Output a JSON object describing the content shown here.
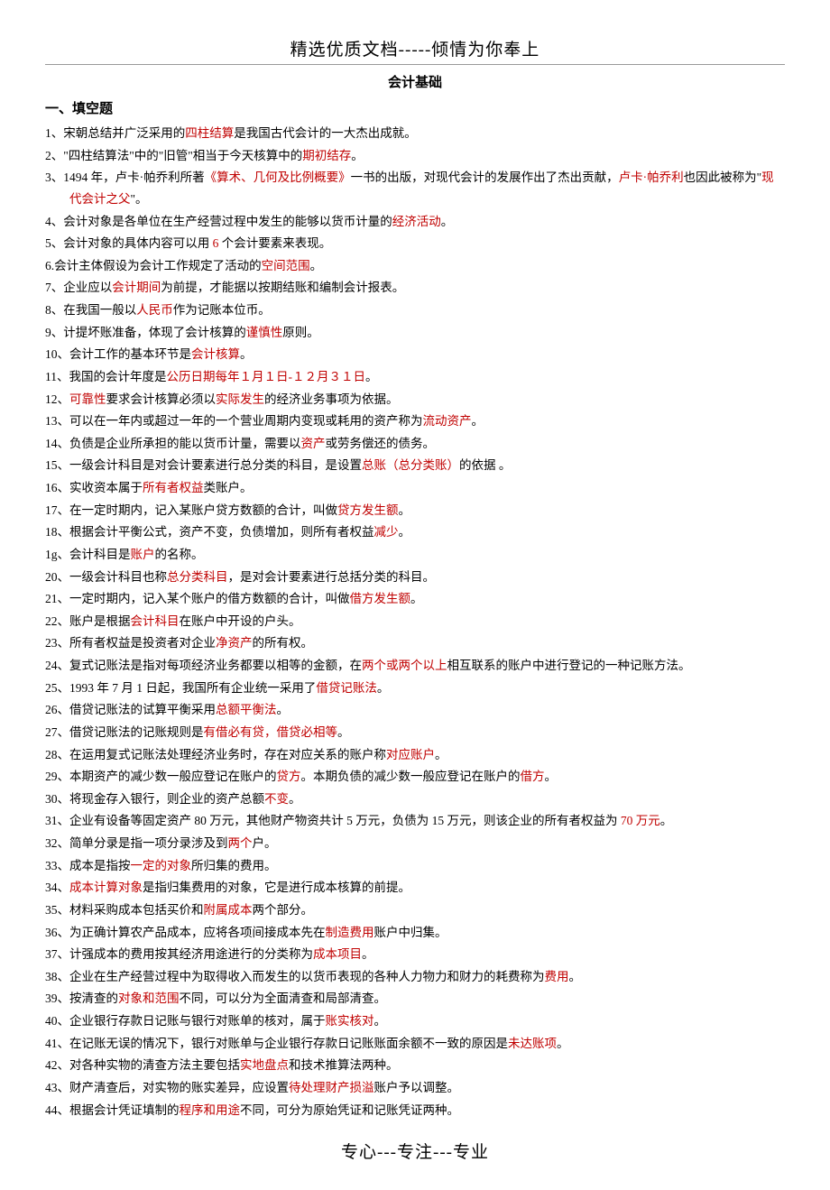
{
  "header": {
    "top": "精选优质文档-----倾情为你奉上",
    "title": "会计基础"
  },
  "section": {
    "title": "一、填空题"
  },
  "items": [
    {
      "n": "1、",
      "parts": [
        {
          "t": "宋朝总结并广泛采用的"
        },
        {
          "t": "四柱结算",
          "r": true
        },
        {
          "t": "是我国古代会计的一大杰出成就。"
        }
      ]
    },
    {
      "n": "2、",
      "parts": [
        {
          "t": "\"四柱结算法\"中的\"旧管\"相当于今天核算中的"
        },
        {
          "t": "期初结存",
          "r": true
        },
        {
          "t": "。"
        }
      ]
    },
    {
      "n": "3、",
      "parts": [
        {
          "t": "1494 年，卢卡·帕乔利所著"
        },
        {
          "t": "《算术、几何及比例概要》",
          "r": true
        },
        {
          "t": "一书的出版，对现代会计的发展作出了杰出贡献，"
        },
        {
          "t": "卢卡·帕乔利",
          "r": true
        },
        {
          "t": "也因此被称为\""
        },
        {
          "t": "现代会计之父",
          "r": true
        },
        {
          "t": "\"。"
        }
      ]
    },
    {
      "n": "4、",
      "parts": [
        {
          "t": "会计对象是各单位在生产经营过程中发生的能够以货币计量的"
        },
        {
          "t": "经济活动",
          "r": true
        },
        {
          "t": "。"
        }
      ]
    },
    {
      "n": "5、",
      "parts": [
        {
          "t": "会计对象的具体内容可以用 "
        },
        {
          "t": "6",
          "r": true
        },
        {
          "t": " 个会计要素来表现。"
        }
      ]
    },
    {
      "n": "6.",
      "parts": [
        {
          "t": "会计主体假设为会计工作规定了活动的"
        },
        {
          "t": "空间范围",
          "r": true
        },
        {
          "t": "。"
        }
      ]
    },
    {
      "n": "7、",
      "parts": [
        {
          "t": "企业应以"
        },
        {
          "t": "会计期间",
          "r": true
        },
        {
          "t": "为前提，才能据以按期结账和编制会计报表。"
        }
      ]
    },
    {
      "n": "8、",
      "parts": [
        {
          "t": "在我国一般以"
        },
        {
          "t": "人民币",
          "r": true
        },
        {
          "t": "作为记账本位币。"
        }
      ]
    },
    {
      "n": "9、",
      "parts": [
        {
          "t": "计提坏账准备，体现了会计核算的"
        },
        {
          "t": "谨慎性",
          "r": true
        },
        {
          "t": "原则。"
        }
      ]
    },
    {
      "n": "10、",
      "parts": [
        {
          "t": "会计工作的基本环节是"
        },
        {
          "t": "会计核算",
          "r": true
        },
        {
          "t": "。"
        }
      ]
    },
    {
      "n": "11、",
      "parts": [
        {
          "t": "我国的会计年度是"
        },
        {
          "t": "公历日期每年１月１日-１２月３１日",
          "r": true
        },
        {
          "t": "。"
        }
      ]
    },
    {
      "n": "12、",
      "parts": [
        {
          "t": "可靠性",
          "r": true
        },
        {
          "t": "要求会计核算必须以"
        },
        {
          "t": "实际发生",
          "r": true
        },
        {
          "t": "的经济业务事项为依据。"
        }
      ]
    },
    {
      "n": "13、",
      "parts": [
        {
          "t": "可以在一年内或超过一年的一个营业周期内变现或耗用的资产称为"
        },
        {
          "t": "流动资产",
          "r": true
        },
        {
          "t": "。"
        }
      ]
    },
    {
      "n": "14、",
      "parts": [
        {
          "t": "负债是企业所承担的能以货币计量，需要以"
        },
        {
          "t": "资产",
          "r": true
        },
        {
          "t": "或劳务偿还的债务。"
        }
      ]
    },
    {
      "n": "15、",
      "parts": [
        {
          "t": "一级会计科目是对会计要素进行总分类的科目，是设置"
        },
        {
          "t": "总账（总分类账）",
          "r": true
        },
        {
          "t": "的依据 。"
        }
      ]
    },
    {
      "n": "16、",
      "parts": [
        {
          "t": "实收资本属于"
        },
        {
          "t": "所有者权益",
          "r": true
        },
        {
          "t": "类账户。"
        }
      ]
    },
    {
      "n": "17、",
      "parts": [
        {
          "t": "在一定时期内，记入某账户贷方数额的合计，叫做"
        },
        {
          "t": "贷方发生额",
          "r": true
        },
        {
          "t": "。"
        }
      ]
    },
    {
      "n": "18、",
      "parts": [
        {
          "t": "根据会计平衡公式，资产不变，负债增加，则所有者权益"
        },
        {
          "t": "减少",
          "r": true
        },
        {
          "t": "。"
        }
      ]
    },
    {
      "n": "1g、",
      "parts": [
        {
          "t": "会计科目是"
        },
        {
          "t": "账户",
          "r": true
        },
        {
          "t": "的名称。"
        }
      ]
    },
    {
      "n": "20、",
      "parts": [
        {
          "t": "一级会计科目也称"
        },
        {
          "t": "总分类科目",
          "r": true
        },
        {
          "t": "，是对会计要素进行总括分类的科目。"
        }
      ]
    },
    {
      "n": "21、",
      "parts": [
        {
          "t": "一定时期内，记入某个账户的借方数额的合计，叫做"
        },
        {
          "t": "借方发生额",
          "r": true
        },
        {
          "t": "。"
        }
      ]
    },
    {
      "n": "22、",
      "parts": [
        {
          "t": "账户是根据"
        },
        {
          "t": "会计科目",
          "r": true
        },
        {
          "t": "在账户中开设的户头。"
        }
      ]
    },
    {
      "n": "23、",
      "parts": [
        {
          "t": "所有者权益是投资者对企业"
        },
        {
          "t": "净资产",
          "r": true
        },
        {
          "t": "的所有权。"
        }
      ]
    },
    {
      "n": "24、",
      "parts": [
        {
          "t": "复式记账法是指对每项经济业务都要以相等的金额，在"
        },
        {
          "t": "两个或两个以上",
          "r": true
        },
        {
          "t": "相互联系的账户中进行登记的一种记账方法。"
        }
      ]
    },
    {
      "n": "25、",
      "parts": [
        {
          "t": "1993 年 7 月 1 日起，我国所有企业统一采用了"
        },
        {
          "t": "借贷记账法",
          "r": true
        },
        {
          "t": "。"
        }
      ]
    },
    {
      "n": "26、",
      "parts": [
        {
          "t": "借贷记账法的试算平衡采用"
        },
        {
          "t": "总额平衡法",
          "r": true
        },
        {
          "t": "。"
        }
      ]
    },
    {
      "n": "27、",
      "parts": [
        {
          "t": "借贷记账法的记账规则是"
        },
        {
          "t": "有借必有贷，借贷必相等",
          "r": true
        },
        {
          "t": "。"
        }
      ]
    },
    {
      "n": "28、",
      "parts": [
        {
          "t": "在运用复式记账法处理经济业务时，存在对应关系的账户称"
        },
        {
          "t": "对应账户",
          "r": true
        },
        {
          "t": "。"
        }
      ]
    },
    {
      "n": "29、",
      "parts": [
        {
          "t": "本期资产的减少数一般应登记在账户的"
        },
        {
          "t": "贷方",
          "r": true
        },
        {
          "t": "。本期负债的减少数一般应登记在账户的"
        },
        {
          "t": "借方",
          "r": true
        },
        {
          "t": "。"
        }
      ]
    },
    {
      "n": "30、",
      "parts": [
        {
          "t": "将现金存入银行，则企业的资产总额"
        },
        {
          "t": "不变",
          "r": true
        },
        {
          "t": "。"
        }
      ]
    },
    {
      "n": "31、",
      "parts": [
        {
          "t": "企业有设备等固定资产 80 万元，其他财产物资共计 5 万元，负债为 15 万元，则该企业的所有者权益为 "
        },
        {
          "t": "70 万元",
          "r": true
        },
        {
          "t": "。"
        }
      ]
    },
    {
      "n": "32、",
      "parts": [
        {
          "t": "简单分录是指一项分录涉及到"
        },
        {
          "t": "两个",
          "r": true
        },
        {
          "t": "户。"
        }
      ]
    },
    {
      "n": "33、",
      "parts": [
        {
          "t": "成本是指按"
        },
        {
          "t": "一定的对象",
          "r": true
        },
        {
          "t": "所归集的费用。"
        }
      ]
    },
    {
      "n": "34、",
      "parts": [
        {
          "t": "成本计算对象",
          "r": true
        },
        {
          "t": "是指归集费用的对象，它是进行成本核算的前提。"
        }
      ]
    },
    {
      "n": "35、",
      "parts": [
        {
          "t": "材料采购成本包括买价和"
        },
        {
          "t": "附属成本",
          "r": true
        },
        {
          "t": "两个部分。"
        }
      ]
    },
    {
      "n": "36、",
      "parts": [
        {
          "t": "为正确计算农产品成本，应将各项间接成本先在"
        },
        {
          "t": "制造费用",
          "r": true
        },
        {
          "t": "账户中归集。"
        }
      ]
    },
    {
      "n": "37、",
      "parts": [
        {
          "t": "计强成本的费用按其经济用途进行的分类称为"
        },
        {
          "t": "成本项目",
          "r": true
        },
        {
          "t": "。"
        }
      ]
    },
    {
      "n": "38、",
      "parts": [
        {
          "t": "企业在生产经营过程中为取得收入而发生的以货币表现的各种人力物力和财力的耗费称为"
        },
        {
          "t": "费用",
          "r": true
        },
        {
          "t": "。"
        }
      ]
    },
    {
      "n": "39、",
      "parts": [
        {
          "t": "按清查的"
        },
        {
          "t": "对象和范围",
          "r": true
        },
        {
          "t": "不同，可以分为全面清查和局部清查。"
        }
      ]
    },
    {
      "n": "40、",
      "parts": [
        {
          "t": "企业银行存款日记账与银行对账单的核对，属于"
        },
        {
          "t": "账实核对",
          "r": true
        },
        {
          "t": "。"
        }
      ]
    },
    {
      "n": "41、",
      "parts": [
        {
          "t": "在记账无误的情况下，银行对账单与企业银行存款日记账账面余额不一致的原因是"
        },
        {
          "t": "未达账项",
          "r": true
        },
        {
          "t": "。"
        }
      ]
    },
    {
      "n": "42、",
      "parts": [
        {
          "t": "对各种实物的清查方法主要包括"
        },
        {
          "t": "实地盘点",
          "r": true
        },
        {
          "t": "和技术推算法两种。"
        }
      ]
    },
    {
      "n": "43、",
      "parts": [
        {
          "t": "财产清查后，对实物的账实差异，应设置"
        },
        {
          "t": "待处理财产损溢",
          "r": true
        },
        {
          "t": "账户予以调整。"
        }
      ]
    },
    {
      "n": "44、",
      "parts": [
        {
          "t": "根据会计凭证填制的"
        },
        {
          "t": "程序和用途",
          "r": true
        },
        {
          "t": "不同，可分为原始凭证和记账凭证两种。"
        }
      ]
    }
  ],
  "footer": "专心---专注---专业"
}
